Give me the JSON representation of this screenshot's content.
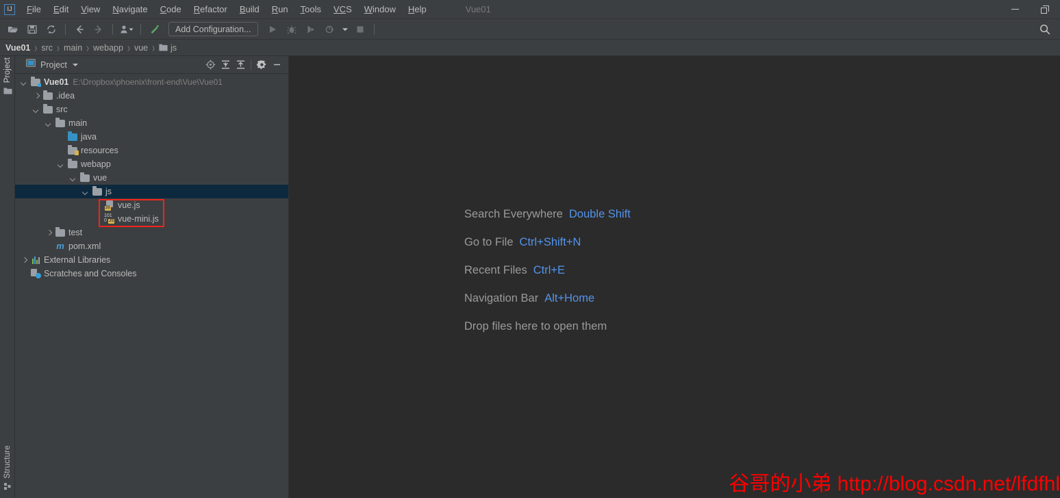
{
  "window": {
    "title": "Vue01",
    "app_icon": "intellij-idea-logo",
    "minimize": "minimize",
    "restore": "restore"
  },
  "menu": {
    "items": [
      {
        "label": "File",
        "mnemonic": "F",
        "rest": "ile"
      },
      {
        "label": "Edit",
        "mnemonic": "E",
        "rest": "dit"
      },
      {
        "label": "View",
        "mnemonic": "V",
        "rest": "iew"
      },
      {
        "label": "Navigate",
        "mnemonic": "N",
        "rest": "avigate"
      },
      {
        "label": "Code",
        "mnemonic": "C",
        "rest": "ode"
      },
      {
        "label": "Refactor",
        "mnemonic": "R",
        "rest": "efactor"
      },
      {
        "label": "Build",
        "mnemonic": "B",
        "rest": "uild"
      },
      {
        "label": "Run",
        "mnemonic": "R",
        "rest": "un"
      },
      {
        "label": "Tools",
        "mnemonic": "T",
        "rest": "ools"
      },
      {
        "label": "VCS",
        "mnemonic": "VC",
        "rest": "S"
      },
      {
        "label": "Window",
        "mnemonic": "W",
        "rest": "indow"
      },
      {
        "label": "Help",
        "mnemonic": "H",
        "rest": "elp"
      }
    ]
  },
  "toolbar": {
    "open_icon": "open-folder-icon",
    "save_icon": "save-icon",
    "sync_icon": "sync-icon",
    "back_icon": "back-arrow-icon",
    "forward_icon": "forward-arrow-icon",
    "vcs_icon": "vcs-user-icon",
    "build_icon": "build-hammer-icon",
    "run_config_label": "Add Configuration...",
    "run_icon": "run-icon",
    "debug_icon": "debug-icon",
    "coverage_icon": "run-with-coverage-icon",
    "profile_icon": "profiler-icon",
    "stop_icon": "stop-icon",
    "search_icon": "search-icon"
  },
  "breadcrumb": {
    "separator": "›",
    "items": [
      {
        "label": "Vue01",
        "bold": true,
        "icon": null
      },
      {
        "label": "src",
        "bold": false,
        "icon": null
      },
      {
        "label": "main",
        "bold": false,
        "icon": null
      },
      {
        "label": "webapp",
        "bold": false,
        "icon": null
      },
      {
        "label": "vue",
        "bold": false,
        "icon": null
      },
      {
        "label": "js",
        "bold": false,
        "icon": "folder-icon"
      }
    ]
  },
  "left_strip": {
    "top_tab": {
      "label": "Project",
      "icon": "folder-icon"
    },
    "bottom_tab": {
      "label": "Structure",
      "icon": "structure-icon"
    }
  },
  "project_panel": {
    "title": "Project",
    "dropdown_icon": "chevron-down-icon",
    "tools": [
      {
        "name": "locate-icon"
      },
      {
        "name": "expand-all-icon"
      },
      {
        "name": "collapse-all-icon"
      },
      {
        "name": "settings-gear-icon"
      },
      {
        "name": "hide-panel-icon"
      }
    ],
    "tree": [
      {
        "indent": 0,
        "arrow": "down",
        "icon": "project-module-icon",
        "label": "Vue01",
        "bold": true,
        "path": "E:\\Dropbox\\phoenix\\front-end\\Vue\\Vue01",
        "selected": false
      },
      {
        "indent": 1,
        "arrow": "right",
        "icon": "folder-icon",
        "label": ".idea",
        "bold": false,
        "path": "",
        "selected": false
      },
      {
        "indent": 1,
        "arrow": "down",
        "icon": "folder-icon",
        "label": "src",
        "bold": false,
        "path": "",
        "selected": false
      },
      {
        "indent": 2,
        "arrow": "down",
        "icon": "folder-icon",
        "label": "main",
        "bold": false,
        "path": "",
        "selected": false
      },
      {
        "indent": 3,
        "arrow": "none",
        "icon": "source-folder-icon",
        "label": "java",
        "bold": false,
        "path": "",
        "selected": false
      },
      {
        "indent": 3,
        "arrow": "none",
        "icon": "resources-folder-icon",
        "label": "resources",
        "bold": false,
        "path": "",
        "selected": false
      },
      {
        "indent": 3,
        "arrow": "down",
        "icon": "folder-icon",
        "label": "webapp",
        "bold": false,
        "path": "",
        "selected": false
      },
      {
        "indent": 4,
        "arrow": "down",
        "icon": "folder-icon",
        "label": "vue",
        "bold": false,
        "path": "",
        "selected": false
      },
      {
        "indent": 5,
        "arrow": "down",
        "icon": "folder-icon",
        "label": "js",
        "bold": false,
        "path": "",
        "selected": true
      },
      {
        "indent": 6,
        "arrow": "none",
        "icon": "javascript-file-icon",
        "label": "vue.js",
        "bold": false,
        "path": "",
        "selected": false
      },
      {
        "indent": 6,
        "arrow": "none",
        "icon": "minified-javascript-file-icon",
        "label": "vue-mini.js",
        "bold": false,
        "path": "",
        "selected": false
      },
      {
        "indent": 2,
        "arrow": "right",
        "icon": "folder-icon",
        "label": "test",
        "bold": false,
        "path": "",
        "selected": false
      },
      {
        "indent": 2,
        "arrow": "none",
        "icon": "maven-file-icon",
        "label": "pom.xml",
        "bold": false,
        "path": "",
        "selected": false
      },
      {
        "indent": 0,
        "arrow": "right",
        "icon": "external-libraries-icon",
        "label": "External Libraries",
        "bold": false,
        "path": "",
        "selected": false
      },
      {
        "indent": 0,
        "arrow": "none",
        "icon": "scratches-icon",
        "label": "Scratches and Consoles",
        "bold": false,
        "path": "",
        "selected": false
      }
    ],
    "highlight_box": {
      "color": "#f5221b",
      "targets": [
        "vue.js",
        "vue-mini.js"
      ]
    }
  },
  "editor": {
    "hints": [
      {
        "label": "Search Everywhere",
        "key": "Double Shift"
      },
      {
        "label": "Go to File",
        "key": "Ctrl+Shift+N"
      },
      {
        "label": "Recent Files",
        "key": "Ctrl+E"
      },
      {
        "label": "Navigation Bar",
        "key": "Alt+Home"
      },
      {
        "label": "Drop files here to open them",
        "key": ""
      }
    ],
    "watermark": "谷哥的小弟 http://blog.csdn.net/lfdfhl"
  },
  "colors": {
    "panel_bg": "#3c3f41",
    "editor_bg": "#2b2b2b",
    "selection": "#0d293e",
    "accent_link": "#5394ec",
    "text": "#bbbbbb",
    "muted_text": "#808080",
    "annotation_red": "#f5221b",
    "watermark_red": "#ff0000"
  }
}
